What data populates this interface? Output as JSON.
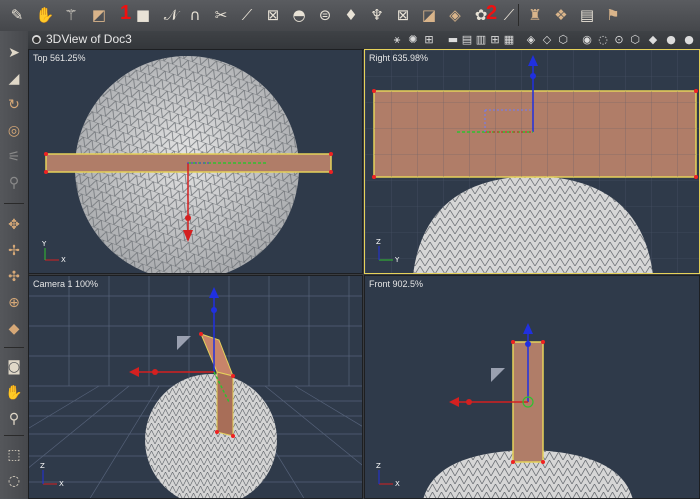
{
  "window": {
    "title": "3DView of Doc3"
  },
  "toolbar": {
    "callout_1": "1",
    "callout_2": "2",
    "buttons": [
      "paint-brush-icon",
      "hand-move-icon",
      "magic-wand-icon",
      "select-tool-icon",
      "primitive-box-icon",
      "pen-tool-icon",
      "magnet-icon",
      "scissors-icon",
      "split-icon",
      "bounding-box-icon",
      "dome-icon",
      "extrude-icon",
      "bend-icon",
      "lathe-icon",
      "boolean-icon",
      "shader-icon",
      "deformer-icon",
      "sketch-icon",
      "render-icon",
      "brush-icon",
      "figure-icon",
      "cloth-icon",
      "box-icon",
      "shelf-icon"
    ]
  },
  "left_tools": [
    "arrow-select-icon",
    "direct-select-icon",
    "rotate-icon",
    "twist-icon",
    "scale-dim-icon",
    "lock-dim-icon",
    "move-icon",
    "move-xyz-icon",
    "move-xz-icon",
    "trackball-icon",
    "box-select-icon",
    "camera-icon",
    "pan-hand-icon",
    "zoom-icon",
    "marquee-icon",
    "lasso-icon"
  ],
  "viewports": [
    {
      "id": "top",
      "label": "Top 561.25%",
      "axis_x": "X",
      "axis_y": "Y"
    },
    {
      "id": "right",
      "label": "Right 635.98%",
      "axis_x": "Y",
      "axis_y": "Z"
    },
    {
      "id": "camera",
      "label": "Camera 1 100%",
      "axis_x": "X",
      "axis_y": "Z"
    },
    {
      "id": "front",
      "label": "Front 902.5%",
      "axis_x": "X",
      "axis_y": "Z"
    }
  ],
  "colors": {
    "object": "#c8846a",
    "selection": "#e6d25a",
    "x_axis": "#d42020",
    "y_axis": "#20c020",
    "z_axis": "#2030e0",
    "sphere": "#d0d0d0"
  }
}
